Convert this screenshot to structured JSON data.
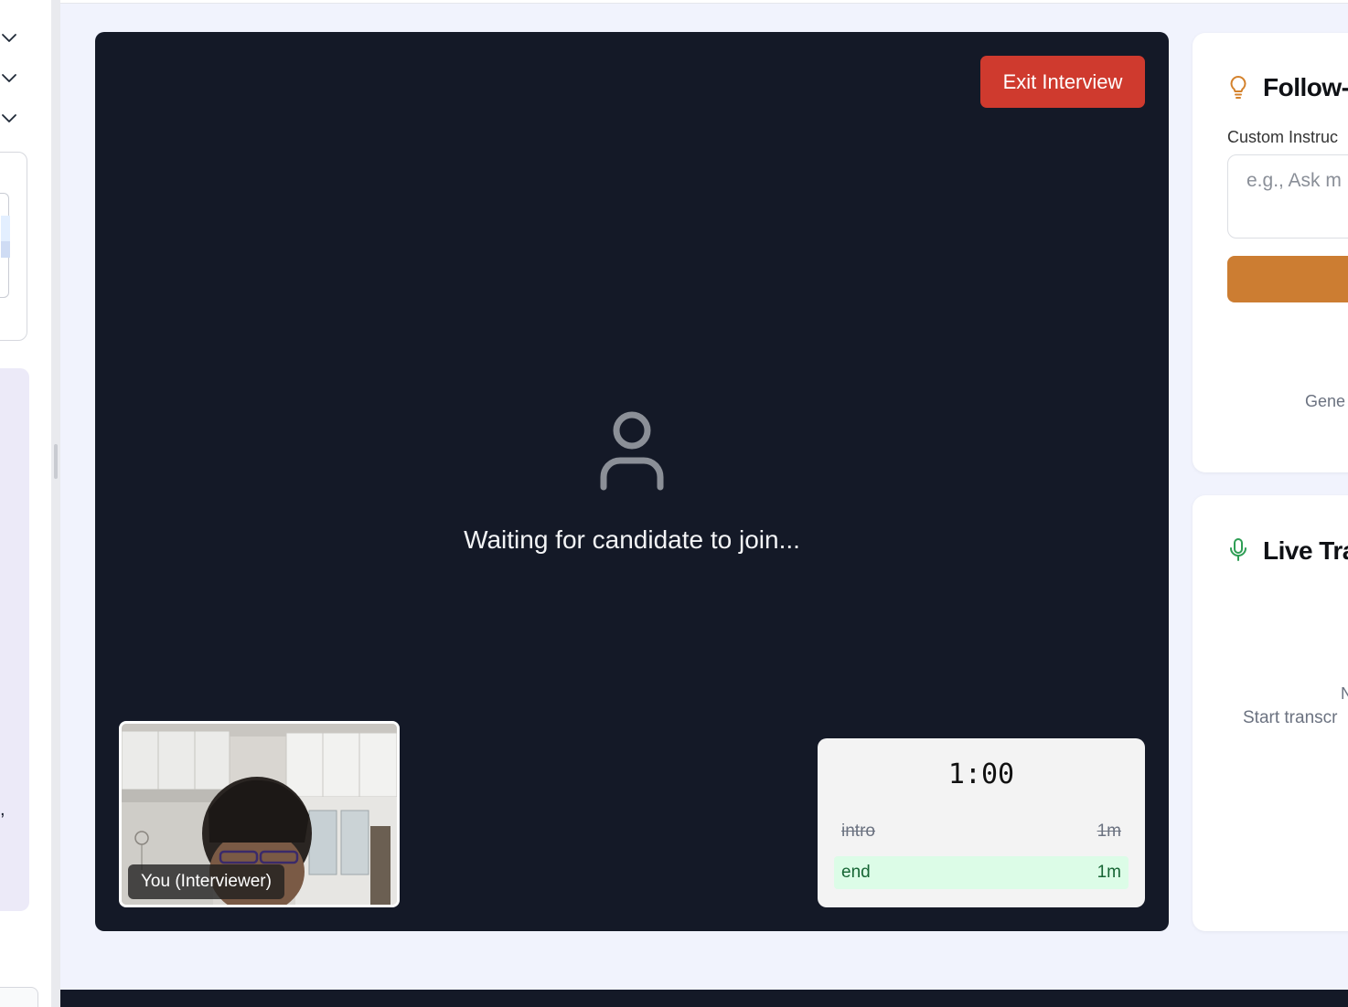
{
  "left_panel": {
    "fragment_text": ","
  },
  "stage": {
    "exit_button_label": "Exit Interview",
    "waiting_message": "Waiting for candidate to join...",
    "self_view_label": "You (Interviewer)",
    "timer": {
      "remaining": "1:00",
      "stages": [
        {
          "name": "intro",
          "duration": "1m",
          "status": "completed"
        },
        {
          "name": "end",
          "duration": "1m",
          "status": "active"
        }
      ]
    }
  },
  "followup_panel": {
    "title": "Follow-",
    "custom_instructions_label": "Custom Instruc",
    "instructions_placeholder": "e.g., Ask m",
    "generate_hint": "Gene"
  },
  "transcript_panel": {
    "title": "Live Tra",
    "empty_title": "N",
    "empty_hint": "Start transcr"
  },
  "colors": {
    "stage_bg": "#141927",
    "exit_button": "#cf3a2e",
    "accent_orange": "#cc7d32",
    "active_stage_bg": "#dcfce7",
    "mic_green": "#2f9e55"
  },
  "icons": {
    "followup": "lightbulb-icon",
    "transcript": "microphone-icon",
    "candidate_placeholder": "user-icon"
  }
}
